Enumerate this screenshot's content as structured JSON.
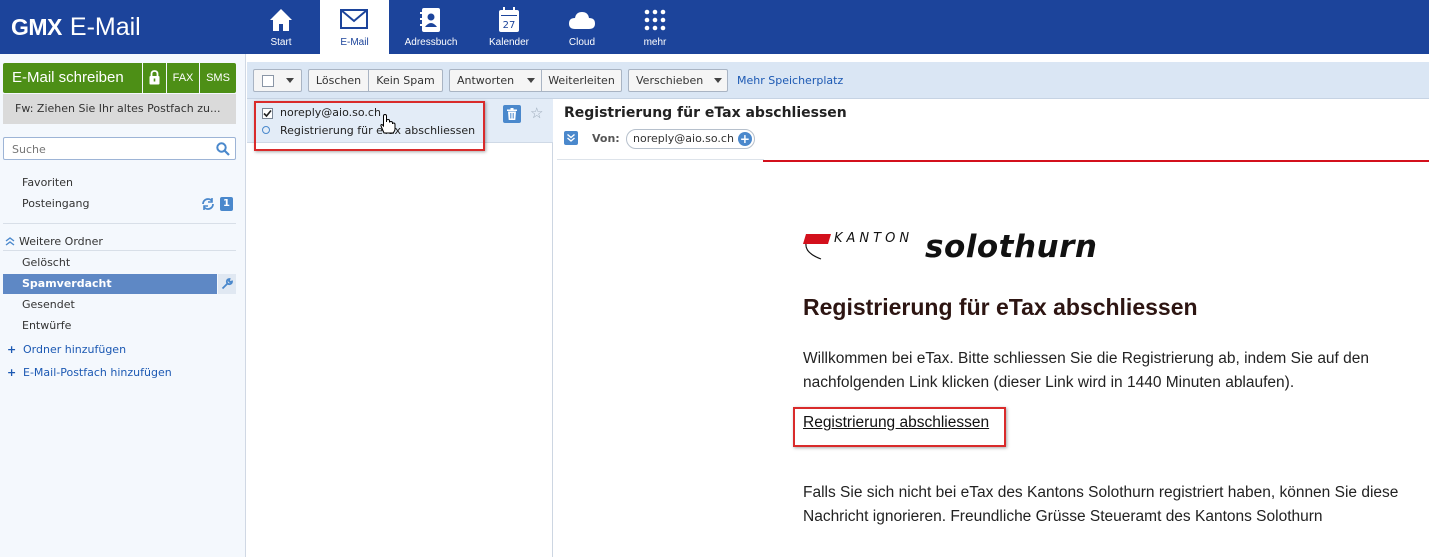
{
  "app": {
    "brand": "GMX",
    "product": "E-Mail"
  },
  "nav": {
    "start": "Start",
    "email": "E-Mail",
    "adressbuch": "Adressbuch",
    "kalender": "Kalender",
    "kalender_day": "27",
    "cloud": "Cloud",
    "mehr": "mehr"
  },
  "sidebar": {
    "compose": "E-Mail schreiben",
    "fax": "FAX",
    "sms": "SMS",
    "draft_notice": "Fw: Ziehen Sie Ihr altes Postfach zu...",
    "search_placeholder": "Suche",
    "favoriten": "Favoriten",
    "posteingang": "Posteingang",
    "posteingang_count": "1",
    "weitere_ordner": "Weitere Ordner",
    "folders": {
      "geloescht": "Gelöscht",
      "spam": "Spamverdacht",
      "gesendet": "Gesendet",
      "entwuerfe": "Entwürfe"
    },
    "add_folder": "Ordner hinzufügen",
    "add_mailbox": "E-Mail-Postfach hinzufügen"
  },
  "toolbar": {
    "loeschen": "Löschen",
    "kein_spam": "Kein Spam",
    "antworten": "Antworten",
    "weiterleiten": "Weiterleiten",
    "verschieben": "Verschieben",
    "mehr_speicher": "Mehr Speicherplatz"
  },
  "message_list": [
    {
      "from": "noreply@aio.so.ch",
      "subject": "Registrierung für eTax abschliessen",
      "checked": true
    }
  ],
  "reading": {
    "subject": "Registrierung für eTax abschliessen",
    "von_label": "Von:",
    "sender": "noreply@aio.so.ch",
    "add_contact": "+",
    "logo_kanton": "KANTON",
    "logo_name": "solothurn",
    "title": "Registrierung für eTax abschliessen",
    "intro": "Willkommen bei eTax. Bitte schliessen Sie die Registrierung ab, indem Sie auf den nachfolgenden Link klicken (dieser Link wird in 1440 Minuten ablaufen).",
    "link": "Registrierung abschliessen",
    "footer": "Falls Sie sich nicht bei eTax des Kantons Solothurn registriert haben, können Sie diese Nachricht ignorieren. Freundliche Grüsse Steueramt des Kantons Solothurn"
  },
  "colors": {
    "topbar": "#1c449b",
    "compose_green": "#4d8f16",
    "accent_blue": "#4a88cc",
    "highlight_red": "#d92b2b",
    "brand_red": "#d3101c"
  }
}
